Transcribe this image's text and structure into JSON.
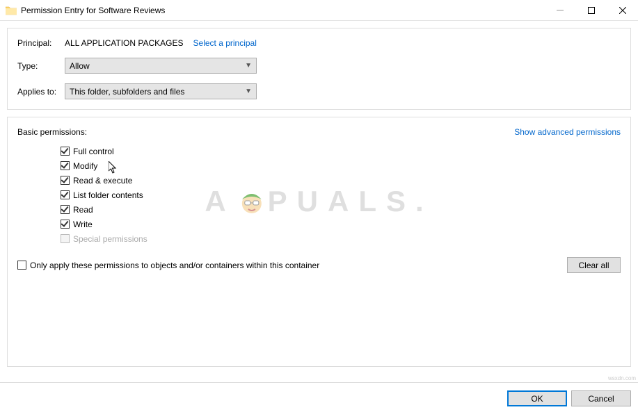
{
  "titlebar": {
    "title": "Permission Entry for Software Reviews"
  },
  "header": {
    "principal_label": "Principal:",
    "principal_value": "ALL APPLICATION PACKAGES",
    "select_principal": "Select a principal",
    "type_label": "Type:",
    "type_value": "Allow",
    "applies_label": "Applies to:",
    "applies_value": "This folder, subfolders and files"
  },
  "basic": {
    "title": "Basic permissions:",
    "advanced_link": "Show advanced permissions",
    "items": [
      {
        "label": "Full control",
        "checked": true,
        "disabled": false
      },
      {
        "label": "Modify",
        "checked": true,
        "disabled": false
      },
      {
        "label": "Read & execute",
        "checked": true,
        "disabled": false
      },
      {
        "label": "List folder contents",
        "checked": true,
        "disabled": false
      },
      {
        "label": "Read",
        "checked": true,
        "disabled": false
      },
      {
        "label": "Write",
        "checked": true,
        "disabled": false
      },
      {
        "label": "Special permissions",
        "checked": false,
        "disabled": true
      }
    ],
    "only_apply": "Only apply these permissions to objects and/or containers within this container",
    "clear_all": "Clear all"
  },
  "footer": {
    "ok": "OK",
    "cancel": "Cancel"
  },
  "watermark": {
    "prefix": "A",
    "suffix": "PUALS."
  },
  "corner": "wsxdn.com"
}
